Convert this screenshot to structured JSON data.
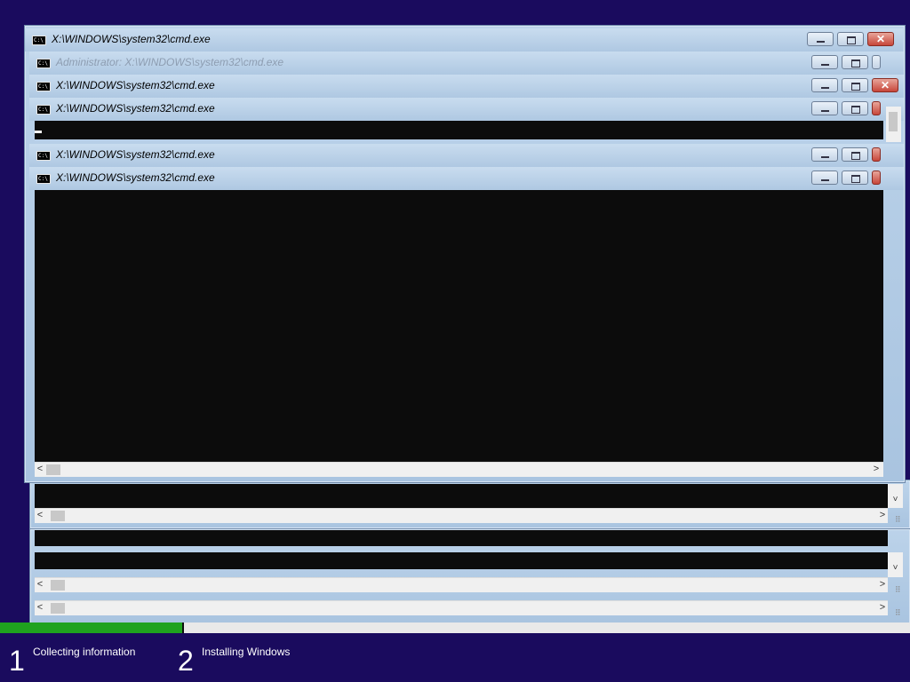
{
  "windows": [
    {
      "title": "X:\\WINDOWS\\system32\\cmd.exe",
      "faded": false
    },
    {
      "title": "Administrator: X:\\WINDOWS\\system32\\cmd.exe",
      "faded": true
    },
    {
      "title": "X:\\WINDOWS\\system32\\cmd.exe",
      "faded": false
    },
    {
      "title": "X:\\WINDOWS\\system32\\cmd.exe",
      "faded": false
    },
    {
      "title": "X:\\WINDOWS\\system32\\cmd.exe",
      "faded": false
    },
    {
      "title": "X:\\WINDOWS\\system32\\cmd.exe",
      "faded": false
    }
  ],
  "icons": {
    "console_icon_label": "C:\\",
    "minimize": "minimize-icon",
    "maximize": "maximize-icon",
    "close": "close-icon",
    "close_glyph": "✕",
    "scroll_left": "<",
    "scroll_right": ">",
    "scroll_down": "˅",
    "grip": "⠿"
  },
  "setup": {
    "progress": 0.2,
    "steps": [
      {
        "number": "1",
        "label": "Collecting information"
      },
      {
        "number": "2",
        "label": "Installing Windows"
      }
    ]
  },
  "colors": {
    "desktop_bg": "#1a0b5e",
    "console_bg": "#0c0c0c",
    "progress": "#1fa21f",
    "titlebar": "#b7cfe8"
  }
}
